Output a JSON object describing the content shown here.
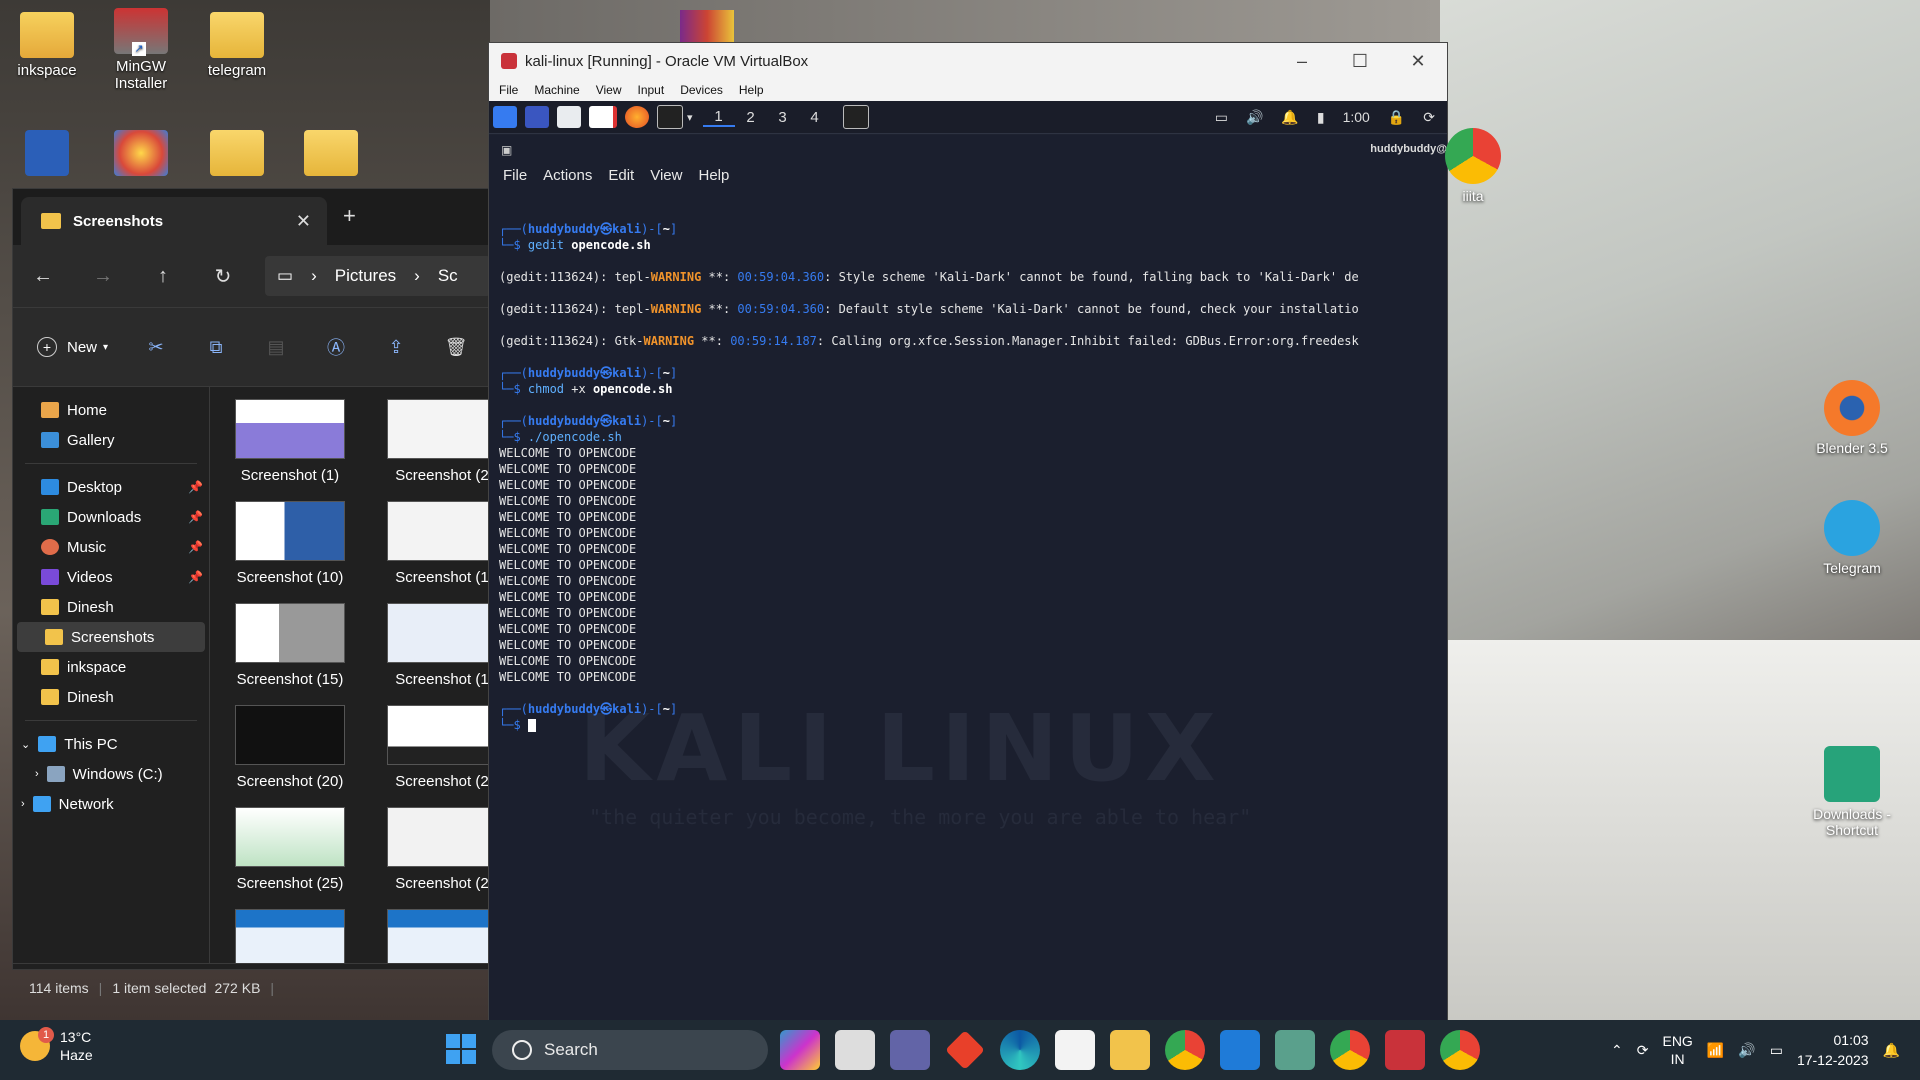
{
  "desktop_left": [
    {
      "label": "inkspace"
    },
    {
      "label": "MinGW Installer"
    },
    {
      "label": "telegram"
    }
  ],
  "explorer": {
    "tab_title": "Screenshots",
    "address": [
      "Pictures",
      "Sc"
    ],
    "new_label": "New",
    "sidebar": [
      {
        "label": "Home"
      },
      {
        "label": "Gallery"
      },
      {
        "label": "Desktop"
      },
      {
        "label": "Downloads"
      },
      {
        "label": "Music"
      },
      {
        "label": "Videos"
      },
      {
        "label": "Dinesh"
      },
      {
        "label": "Screenshots"
      },
      {
        "label": "inkspace"
      },
      {
        "label": "Dinesh"
      },
      {
        "label": "This PC"
      },
      {
        "label": "Windows (C:)"
      },
      {
        "label": "Network"
      }
    ],
    "thumbs": [
      "Screenshot (1)",
      "Screenshot (2",
      "Screenshot (10)",
      "Screenshot (1",
      "Screenshot (15)",
      "Screenshot (1",
      "Screenshot (20)",
      "Screenshot (2",
      "Screenshot (25)",
      "Screenshot (2"
    ],
    "status": {
      "items": "114 items",
      "selected": "1 item selected",
      "size": "272 KB"
    }
  },
  "vbox": {
    "title": "kali-linux [Running] - Oracle VM VirtualBox",
    "menu": [
      "File",
      "Machine",
      "View",
      "Input",
      "Devices",
      "Help"
    ],
    "workspaces": [
      "1",
      "2",
      "3",
      "4"
    ],
    "panel_time": "1:00",
    "term_user": "huddybuddy@",
    "term_menu": [
      "File",
      "Actions",
      "Edit",
      "View",
      "Help"
    ],
    "prompt_user": "huddybuddy",
    "prompt_host": "kali",
    "prompt_dir": "~",
    "cmd1_a": "gedit",
    "cmd1_b": "opencode.sh",
    "w1_a": "(gedit:113624): tepl-",
    "w1_w": "WARNING",
    "w1_b": " **: ",
    "w1_t": "00:59:04.360",
    "w1_c": ": Style scheme 'Kali-Dark' cannot be found, falling back to 'Kali-Dark' de",
    "w2_a": "(gedit:113624): tepl-",
    "w2_w": "WARNING",
    "w2_b": " **: ",
    "w2_t": "00:59:04.360",
    "w2_c": ": Default style scheme 'Kali-Dark' cannot be found, check your installatio",
    "w3_a": "(gedit:113624): Gtk-",
    "w3_w": "WARNING",
    "w3_b": " **: ",
    "w3_t": "00:59:14.187",
    "w3_c": ": Calling org.xfce.Session.Manager.Inhibit failed: GDBus.Error:org.freedesk",
    "cmd2_a": "chmod",
    "cmd2_b": "+x",
    "cmd2_c": "opencode.sh",
    "cmd3": "./opencode.sh",
    "welcome": "WELCOME TO OPENCODE",
    "watermark": "KALI LINUX",
    "quote": "\"the quieter you become, the more you are able to hear\""
  },
  "desktop_right": [
    {
      "label": "iiita"
    },
    {
      "label": "Blender 3.5"
    },
    {
      "label": "Telegram"
    },
    {
      "label": "Downloads - Shortcut"
    }
  ],
  "taskbar": {
    "temp": "13°C",
    "weather": "Haze",
    "weather_badge": "1",
    "search": "Search",
    "lang1": "ENG",
    "lang2": "IN",
    "time": "01:03",
    "date": "17-12-2023"
  }
}
